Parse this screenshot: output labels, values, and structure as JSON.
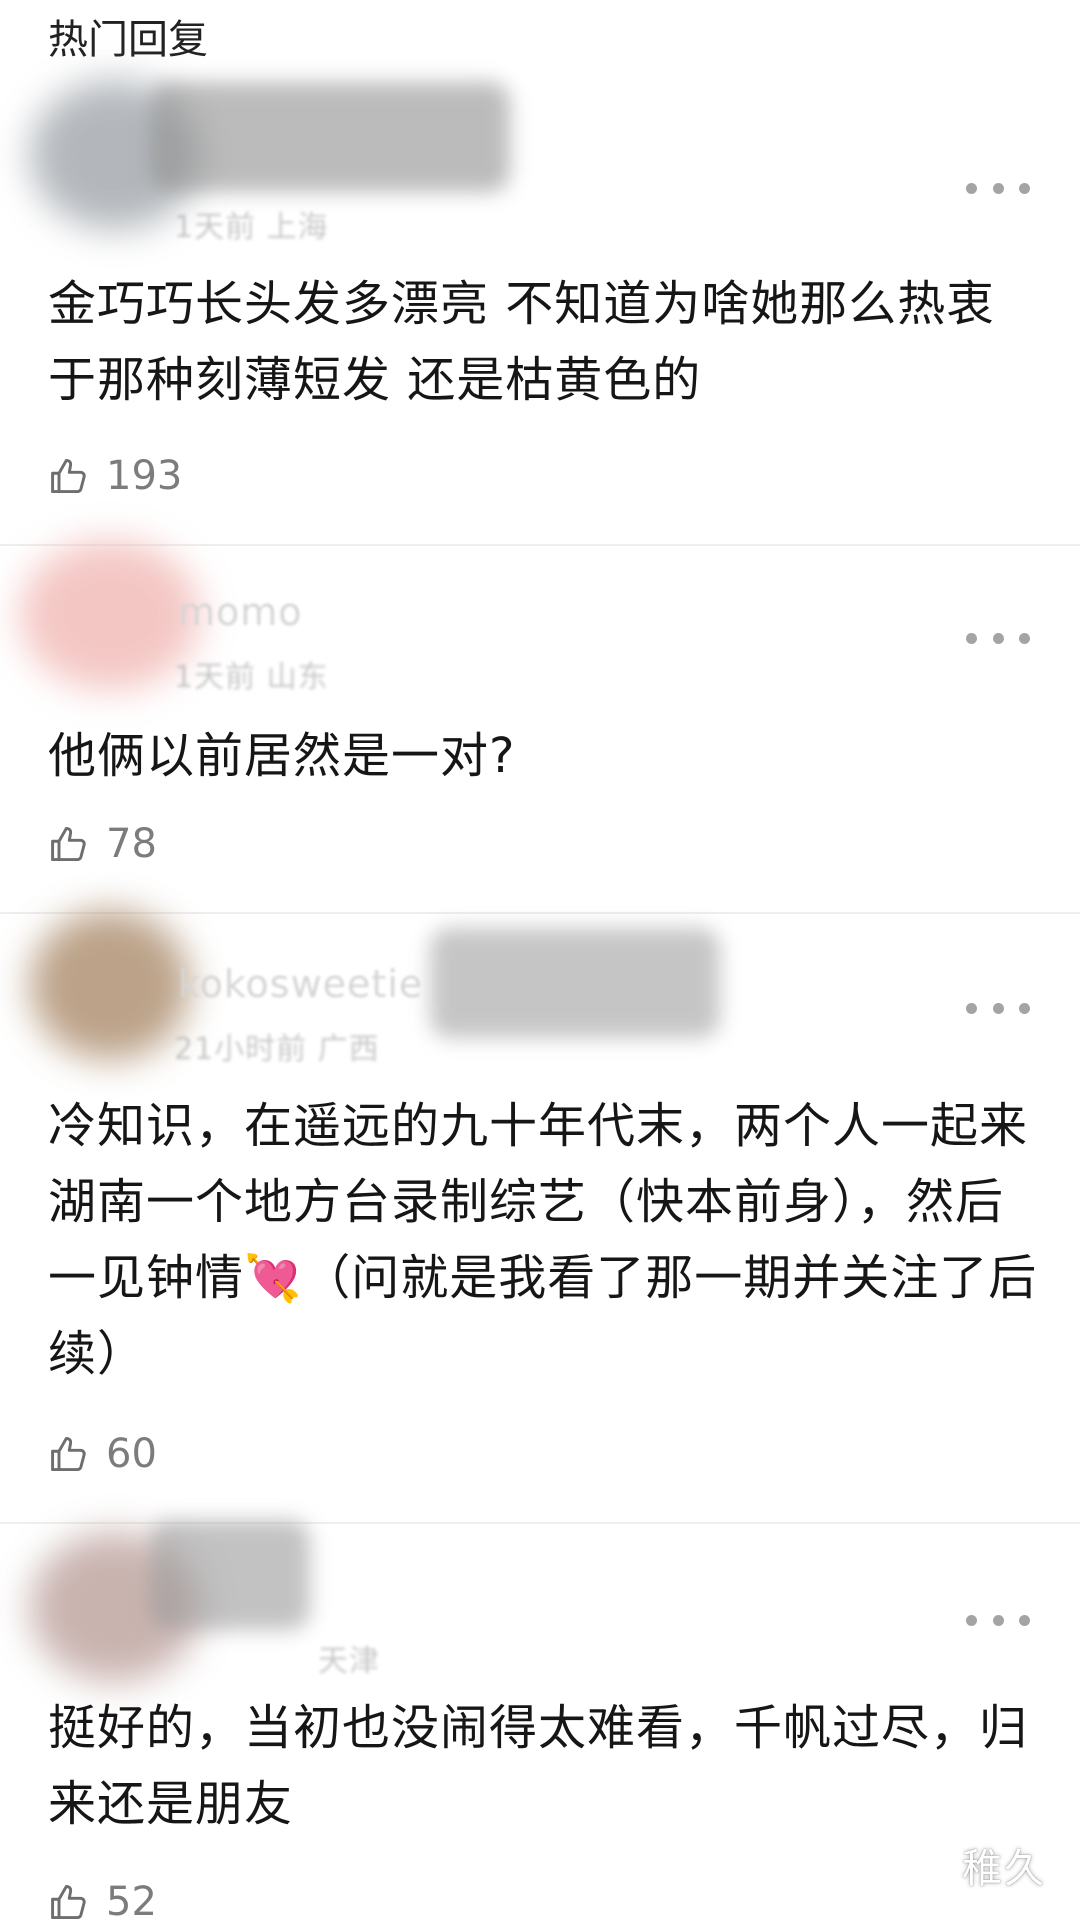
{
  "section_title": "热门回复",
  "comments": [
    {
      "username": "",
      "meta": "1天前 上海",
      "text": "金巧巧长头发多漂亮 不知道为啥她那么热衷于那种刻薄短发 还是枯黄色的",
      "likes": "193"
    },
    {
      "username": "momo",
      "meta": "1天前 山东",
      "text": "他俩以前居然是一对?",
      "likes": "78"
    },
    {
      "username": "kokosweetie",
      "meta": "21小时前 广西",
      "text_before_emoji": "冷知识，在遥远的九十年代末，两个人一起来湖南一个地方台录制综艺（快本前身），然后一见钟情",
      "emoji": "💘",
      "text_after_emoji": "（问就是我看了那一期并关注了后续）",
      "likes": "60"
    },
    {
      "username": "",
      "meta": "天津",
      "text": "挺好的，当初也没闹得太难看，千帆过尽，归来还是朋友",
      "likes": "52"
    }
  ],
  "watermark": "稚久",
  "colors": {
    "text": "#161616",
    "meta": "#b6b6b6",
    "like_count": "#7c7c7c",
    "divider": "#eeeeee"
  },
  "icons": {
    "like": "thumbs-up-icon",
    "more": "more-dots-icon"
  }
}
